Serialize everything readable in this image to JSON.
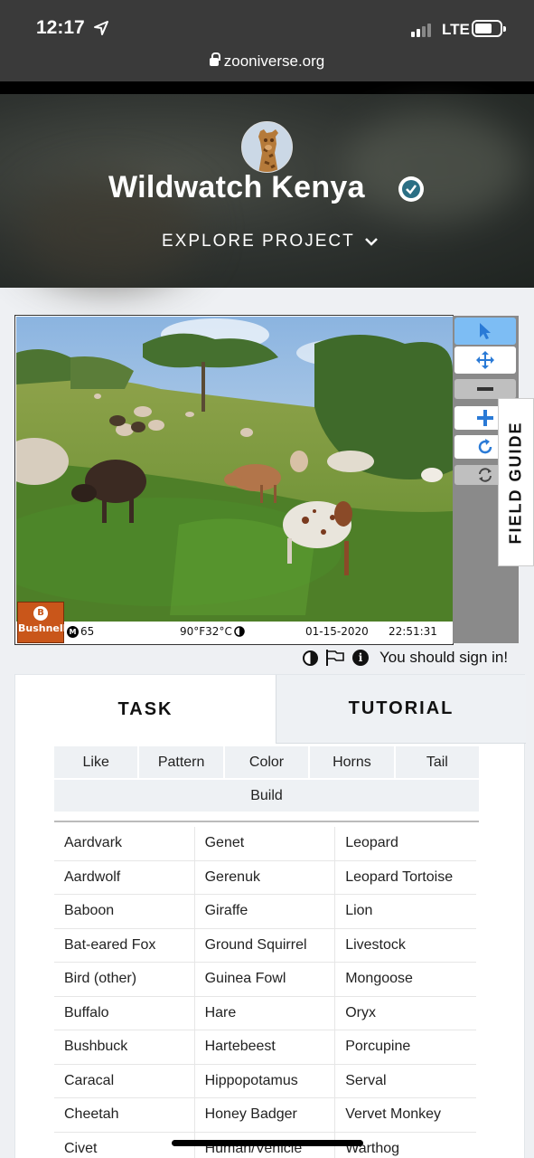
{
  "status_bar": {
    "time": "12:17",
    "network": "LTE",
    "url": "zooniverse.org"
  },
  "project": {
    "title": "Wildwatch Kenya",
    "explore_label": "EXPLORE PROJECT"
  },
  "photo_footer": {
    "brand": "Bushnell",
    "moon_label": "65",
    "temperature": "90°F32°C",
    "date": "01-15-2020",
    "time": "22:51:31"
  },
  "tools": [
    "pointer-icon",
    "move-icon",
    "zoom-out-icon",
    "zoom-in-icon",
    "rotate-icon",
    "reset-icon"
  ],
  "field_guide_label": "FIELD GUIDE",
  "meta": {
    "sign_in": "You should sign in!"
  },
  "tabs": {
    "task": "TASK",
    "tutorial": "TUTORIAL"
  },
  "filters": [
    "Like",
    "Pattern",
    "Color",
    "Horns",
    "Tail",
    "Build"
  ],
  "species": [
    [
      "Aardvark",
      "Genet",
      "Leopard"
    ],
    [
      "Aardwolf",
      "Gerenuk",
      "Leopard Tortoise"
    ],
    [
      "Baboon",
      "Giraffe",
      "Lion"
    ],
    [
      "Bat-eared Fox",
      "Ground Squirrel",
      "Livestock"
    ],
    [
      "Bird (other)",
      "Guinea Fowl",
      "Mongoose"
    ],
    [
      "Buffalo",
      "Hare",
      "Oryx"
    ],
    [
      "Bushbuck",
      "Hartebeest",
      "Porcupine"
    ],
    [
      "Caracal",
      "Hippopotamus",
      "Serval"
    ],
    [
      "Cheetah",
      "Honey Badger",
      "Vervet Monkey"
    ],
    [
      "Civet",
      "Human/Vehicle",
      "Warthog"
    ]
  ]
}
